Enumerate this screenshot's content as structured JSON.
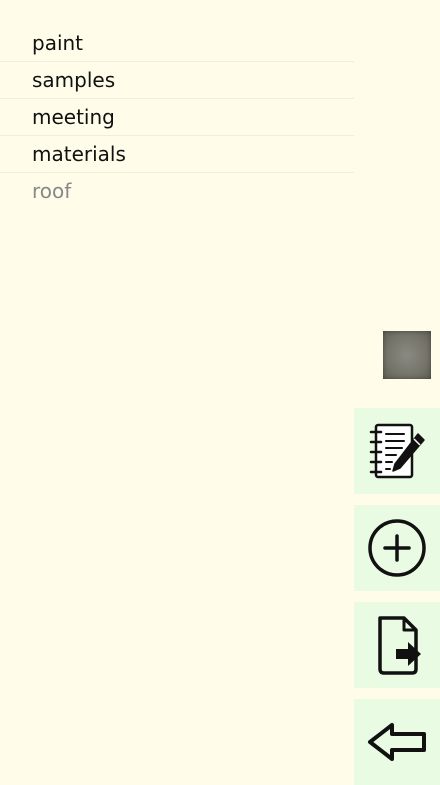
{
  "list": {
    "items": [
      {
        "label": "paint"
      },
      {
        "label": "samples"
      },
      {
        "label": "meeting"
      },
      {
        "label": "materials"
      },
      {
        "label": "roof"
      }
    ]
  },
  "actions": {
    "notes_icon": "notebook-pen-icon",
    "add_icon": "plus-circle-icon",
    "export_icon": "file-export-icon",
    "back_icon": "arrow-left-icon"
  },
  "colors": {
    "background": "#fffdea",
    "button_background": "#e9fbe3",
    "text": "#111111",
    "muted_text": "#888888"
  }
}
